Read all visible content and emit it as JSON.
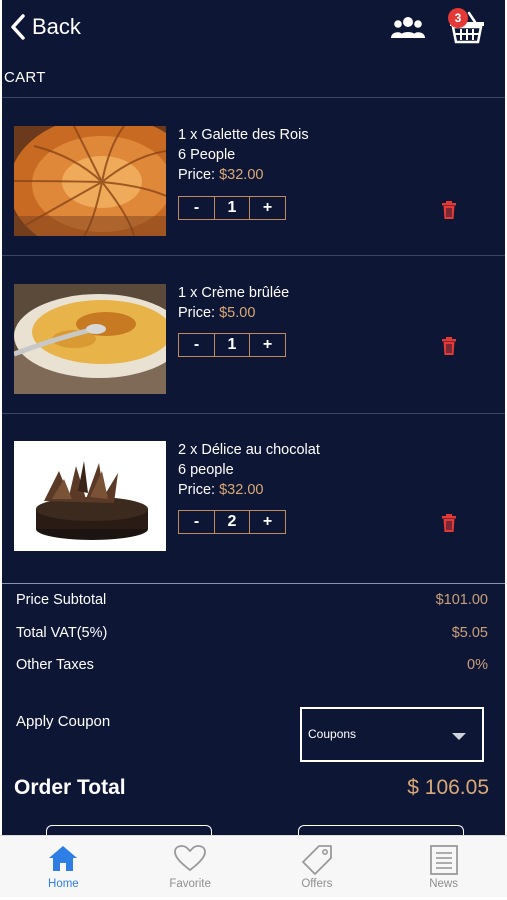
{
  "header": {
    "back_label": "Back",
    "cart_count": "3"
  },
  "page_title": "CART",
  "items": [
    {
      "name": "1 x Galette des Rois",
      "detail": "6 People",
      "price_label": "Price:",
      "price": "$32.00",
      "quantity": "1"
    },
    {
      "name": "1 x Crème brûlée",
      "detail": "",
      "price_label": "Price:",
      "price": "$5.00",
      "quantity": "1"
    },
    {
      "name": "2 x Délice au chocolat",
      "detail": "6 people",
      "price_label": "Price:",
      "price": "$32.00",
      "quantity": "2"
    }
  ],
  "qty_controls": {
    "minus": "-",
    "plus": "+"
  },
  "summary": {
    "subtotal_label": "Price Subtotal",
    "subtotal_value": "$101.00",
    "vat_label": "Total VAT(5%)",
    "vat_value": "$5.05",
    "other_taxes_label": "Other Taxes",
    "other_taxes_value": "0%"
  },
  "coupon": {
    "label": "Apply Coupon",
    "selected": "Coupons"
  },
  "order_total": {
    "label": "Order Total",
    "value": "$ 106.05"
  },
  "tabbar": {
    "tabs": [
      {
        "label": "Home",
        "icon": "home-icon",
        "active": true
      },
      {
        "label": "Favorite",
        "icon": "heart-icon",
        "active": false
      },
      {
        "label": "Offers",
        "icon": "tag-icon",
        "active": false
      },
      {
        "label": "News",
        "icon": "newspaper-icon",
        "active": false
      }
    ]
  },
  "colors": {
    "background": "#0e1635",
    "accent_price": "#d9a876",
    "delete": "#e53935",
    "active_tab": "#2f7ee6"
  }
}
